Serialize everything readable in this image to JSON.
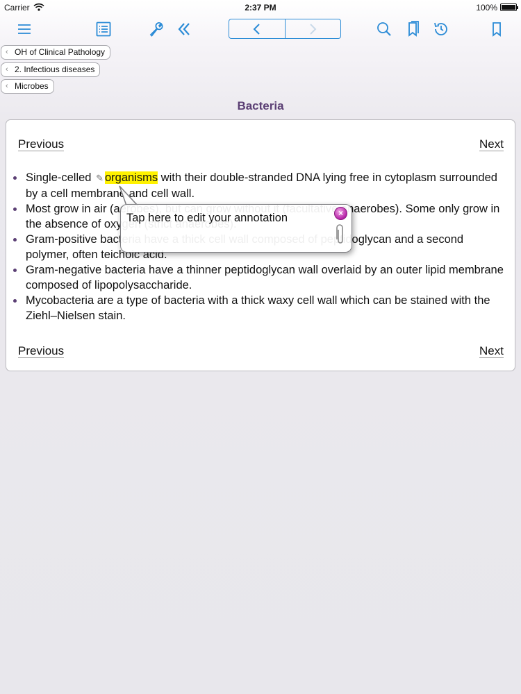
{
  "status_bar": {
    "carrier": "Carrier",
    "time": "2:37 PM",
    "battery": "100%"
  },
  "toolbar": {
    "icons": [
      "menu-icon",
      "list-icon",
      "wrench-icon",
      "double-chevron-left-icon",
      "chevron-left-icon",
      "chevron-right-icon",
      "search-icon",
      "bookmarks-icon",
      "history-icon",
      "bookmark-icon"
    ],
    "accent_color": "#2a8bd6"
  },
  "breadcrumbs": [
    "OH of Clinical Pathology",
    "2. Infectious diseases",
    "Microbes"
  ],
  "page": {
    "title": "Bacteria",
    "title_color": "#5b3f74",
    "previous_label": "Previous",
    "next_label": "Next",
    "bullets": [
      {
        "before": "Single-celled ",
        "highlight": "organisms",
        "after": " with their double-stranded DNA lying free in cytoplasm surrounded by a cell membrane and cell wall."
      },
      {
        "text": "Most grow in air (aerobes), but can grow without it (facultative anaerobes). Some only grow in the absence of oxygen (strict anaerobes)."
      },
      {
        "text": "Gram-positive bacteria have a thick cell wall composed of peptidoglycan and a second polymer, often teichoic acid."
      },
      {
        "text": "Gram-negative bacteria have a thinner peptidoglycan wall overlaid by an outer lipid membrane composed of lipopolysaccharide."
      },
      {
        "text": "Mycobacteria are a type of bacteria with a thick waxy cell wall which can be stained with the Ziehl–Nielsen stain."
      }
    ],
    "highlight_color": "#fff200"
  },
  "annotation": {
    "text": "Tap here to edit your annotation",
    "close_color": "#b521a6"
  }
}
